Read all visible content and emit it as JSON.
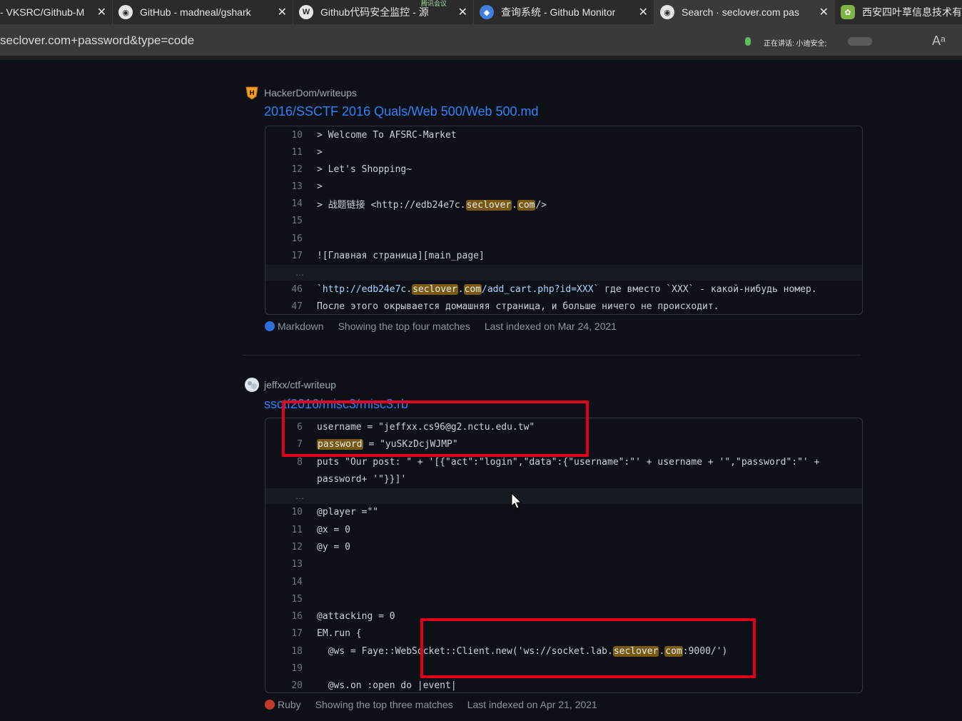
{
  "tabs": [
    {
      "title": "- VKSRC/Github-M",
      "icon": "github-icon"
    },
    {
      "title": "GitHub - madneal/gshark",
      "icon": "github-icon"
    },
    {
      "title": "Github代码安全监控 - 源",
      "icon": "wordpress-icon"
    },
    {
      "title": "查询系统 - Github Monitor",
      "icon": "monitor-icon"
    },
    {
      "title": "Search · seclover.com pas",
      "icon": "github-icon"
    },
    {
      "title": "西安四叶草信息技术有",
      "icon": "clover-icon"
    }
  ],
  "tab_overlay_text": "腾讯会议",
  "address": {
    "text": "seclover.com+password&type=code"
  },
  "status": {
    "text": "正在讲话: 小迪安全;"
  },
  "results": [
    {
      "repo": "HackerDom/writeups",
      "file": "2016/SSCTF 2016 Quals/Web 500/Web 500.md",
      "lines": [
        {
          "n": "10",
          "text": "> Welcome To AFSRC-Market"
        },
        {
          "n": "11",
          "text": ">"
        },
        {
          "n": "12",
          "text": "> Let's Shopping~"
        },
        {
          "n": "13",
          "text": ">"
        },
        {
          "n": "14",
          "pre": "> 战题链接 <http://edb24e7c.",
          "h1": "seclover",
          "mid": ".",
          "h2": "com",
          "post": "/>"
        },
        {
          "n": "15",
          "text": ""
        },
        {
          "n": "16",
          "text": ""
        },
        {
          "n": "17",
          "text": "![Главная страница][main_page]"
        },
        {
          "n": "46",
          "pre": "`http://edb24e7c.",
          "h1": "seclover",
          "mid": ".",
          "h2": "com",
          "post": "/add_cart.php?id=XXX`",
          "rest": " где вместо `XXX` - какой-нибудь номер."
        },
        {
          "n": "47",
          "text": "После этого окрывается домашняя страница, и больше ничего не происходит."
        }
      ],
      "language": "Markdown",
      "language_color": "#083fa1",
      "matches": "Showing the top four matches",
      "indexed": "Last indexed on Mar 24, 2021"
    },
    {
      "repo": "jeffxx/ctf-writeup",
      "file": "ssctf2016/misc3/misc3.rb",
      "lines": [
        {
          "n": "6",
          "text": "username = \"jeffxx.cs96@g2.nctu.edu.tw\""
        },
        {
          "n": "7",
          "hl": "password",
          "text": " = \"yuSKzDcjWJMP\""
        },
        {
          "n": "8",
          "text": "puts \"Our post: \" + '[{\"act\":\"login\",\"data\":{\"username\":\"' + username + '\",\"password\":\"' +"
        },
        {
          "n": "",
          "text": "password+ '\"}}]'"
        },
        {
          "n": "10",
          "text": "@player =\"\""
        },
        {
          "n": "11",
          "text": "@x = 0"
        },
        {
          "n": "12",
          "text": "@y = 0"
        },
        {
          "n": "13",
          "text": ""
        },
        {
          "n": "14",
          "text": ""
        },
        {
          "n": "15",
          "text": ""
        },
        {
          "n": "16",
          "text": "@attacking = 0"
        },
        {
          "n": "17",
          "text": "EM.run {"
        },
        {
          "n": "18",
          "pre": "  @ws = Faye::WebSocket::Client.new('ws://socket.lab.",
          "h1": "seclover",
          "mid": ".",
          "h2": "com",
          "post": ":9000/')"
        },
        {
          "n": "19",
          "text": ""
        },
        {
          "n": "20",
          "text": "  @ws.on :open do |event|"
        }
      ],
      "language": "Ruby",
      "language_color": "#701516",
      "matches": "Showing the top three matches",
      "indexed": "Last indexed on Apr 21, 2021"
    }
  ]
}
